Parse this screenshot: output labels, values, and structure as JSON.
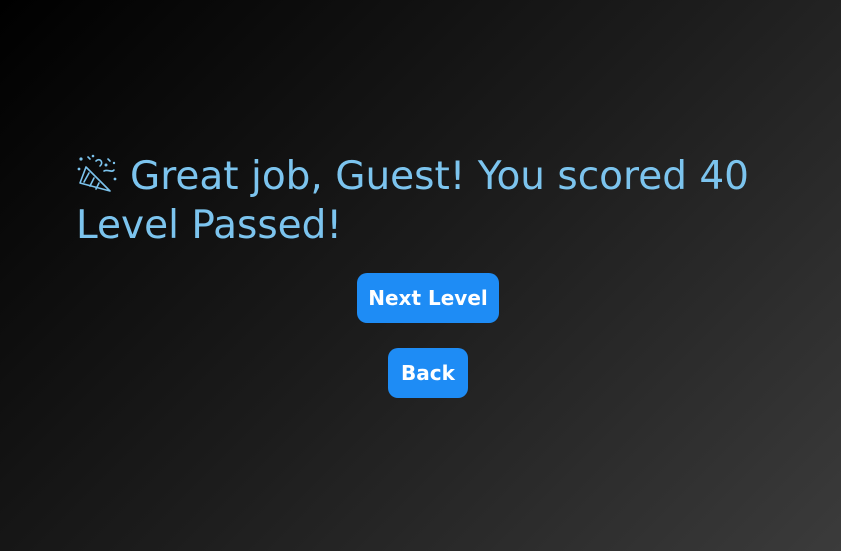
{
  "result": {
    "icon": "party-popper-icon",
    "message": "Great job, Guest! You scored 40",
    "status": "Level Passed!",
    "color": "#7cc4ee"
  },
  "buttons": {
    "next_label": "Next Level",
    "back_label": "Back",
    "color": "#1e8cf5"
  }
}
